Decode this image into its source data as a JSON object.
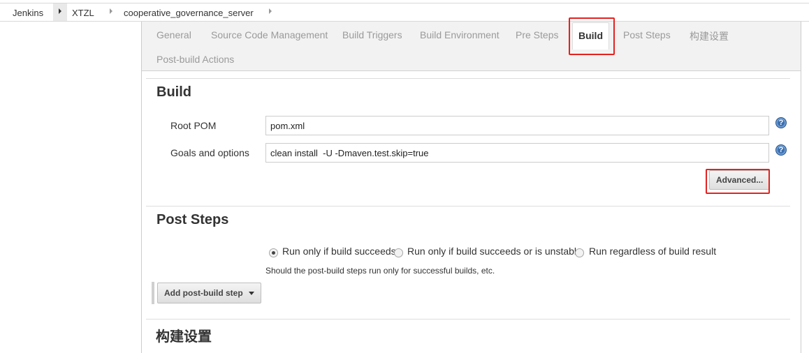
{
  "breadcrumb": {
    "items": [
      "Jenkins",
      "XTZL",
      "cooperative_governance_server"
    ]
  },
  "tabs": [
    {
      "label": "General"
    },
    {
      "label": "Source Code Management"
    },
    {
      "label": "Build Triggers"
    },
    {
      "label": "Build Environment"
    },
    {
      "label": "Pre Steps"
    },
    {
      "label": "Build",
      "active": true
    },
    {
      "label": "Post Steps"
    },
    {
      "label": "构建设置"
    },
    {
      "label": "Post-build Actions"
    }
  ],
  "build": {
    "title": "Build",
    "root_pom_label": "Root POM",
    "root_pom_value": "pom.xml",
    "goals_label": "Goals and options",
    "goals_value": "clean install  -U -Dmaven.test.skip=true",
    "help_glyph": "?",
    "advanced_label": "Advanced..."
  },
  "post_steps": {
    "title": "Post Steps",
    "options": [
      {
        "label": "Run only if build succeeds",
        "checked": true
      },
      {
        "label": "Run only if build succeeds or is unstable",
        "checked": false
      },
      {
        "label": "Run regardless of build result",
        "checked": false
      }
    ],
    "hint": "Should the post-build steps run only for successful builds, etc.",
    "add_step_label": "Add post-build step"
  },
  "build_settings": {
    "title": "构建设置"
  },
  "colors": {
    "highlight": "#e3221f",
    "help_icon": "#3a6fb0"
  }
}
